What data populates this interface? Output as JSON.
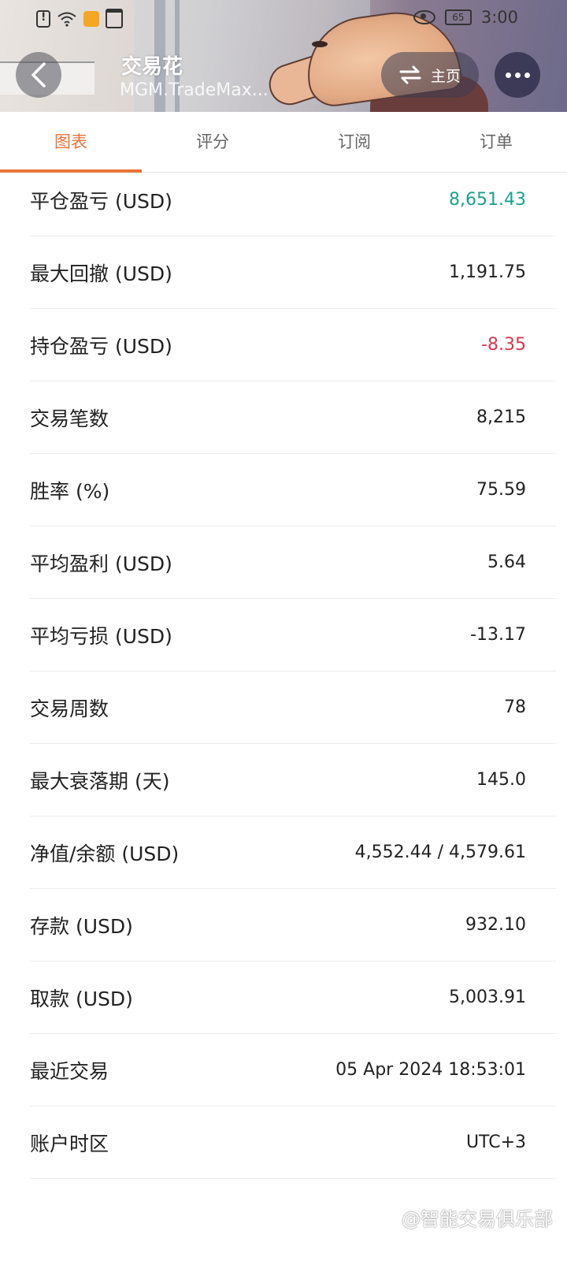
{
  "status_bar": {
    "time": "3:00",
    "battery": "65"
  },
  "header": {
    "title": "交易花",
    "subtitle": "MGM.TradeMax...",
    "home_label": "主页"
  },
  "tabs": [
    "图表",
    "评分",
    "订阅",
    "订单"
  ],
  "active_tab": "图表",
  "colors": {
    "accent": "#e8743b",
    "positive": "#1aa38a",
    "negative": "#d9364f"
  },
  "stats": [
    {
      "label": "平仓盈亏 (USD)",
      "value": "8,651.43",
      "tone": "positive"
    },
    {
      "label": "最大回撤 (USD)",
      "value": "1,191.75",
      "tone": "normal"
    },
    {
      "label": "持仓盈亏 (USD)",
      "value": "-8.35",
      "tone": "negative"
    },
    {
      "label": "交易笔数",
      "value": "8,215",
      "tone": "normal"
    },
    {
      "label": "胜率 (%)",
      "value": "75.59",
      "tone": "normal"
    },
    {
      "label": "平均盈利 (USD)",
      "value": "5.64",
      "tone": "normal"
    },
    {
      "label": "平均亏损 (USD)",
      "value": "-13.17",
      "tone": "normal"
    },
    {
      "label": "交易周数",
      "value": "78",
      "tone": "normal"
    },
    {
      "label": "最大衰落期 (天)",
      "value": "145.0",
      "tone": "normal"
    },
    {
      "label": "净值/余额 (USD)",
      "value": "4,552.44 / 4,579.61",
      "tone": "normal"
    },
    {
      "label": "存款 (USD)",
      "value": "932.10",
      "tone": "normal"
    },
    {
      "label": "取款 (USD)",
      "value": "5,003.91",
      "tone": "normal"
    },
    {
      "label": "最近交易",
      "value": "05 Apr 2024 18:53:01",
      "tone": "normal"
    },
    {
      "label": "账户时区",
      "value": "UTC+3",
      "tone": "normal"
    }
  ],
  "watermark": "@智能交易俱乐部"
}
